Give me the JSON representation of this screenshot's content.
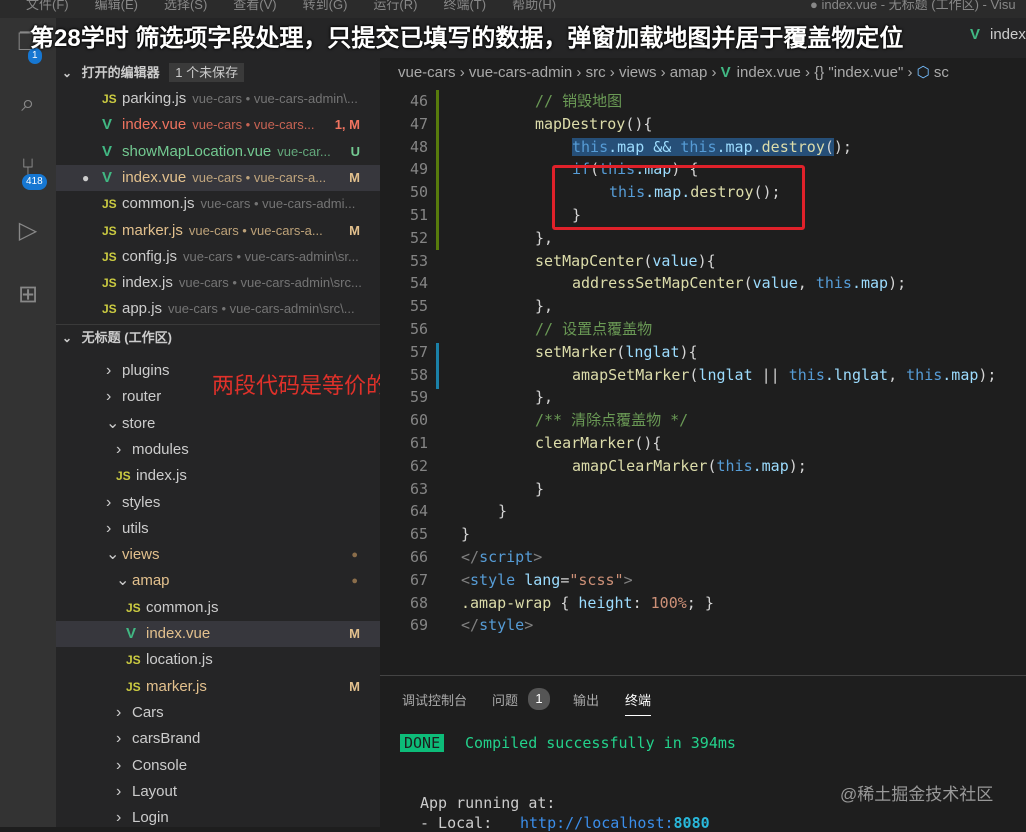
{
  "menubar": {
    "items": [
      "文件(F)",
      "编辑(E)",
      "选择(S)",
      "查看(V)",
      "转到(G)",
      "运行(R)",
      "终端(T)",
      "帮助(H)"
    ],
    "window_title": "● index.vue - 无标题 (工作区) - Visu"
  },
  "overlay_title": "第28学时 筛选项字段处理，只提交已填写的数据，弹窗加载地图并居于覆盖物定位",
  "activity": {
    "explorer_badge": "1",
    "scm_badge": "418"
  },
  "open_editors": {
    "title": "打开的编辑器",
    "unsaved": "1 个未保存",
    "items": [
      {
        "type": "js",
        "name": "parking.js",
        "desc": "vue-cars • vue-cars-admin\\...",
        "status": "",
        "color": "#ccc"
      },
      {
        "type": "vue",
        "name": "index.vue",
        "desc": "vue-cars • vue-cars...",
        "status": "1, M",
        "color": "#f0735f"
      },
      {
        "type": "vue",
        "name": "showMapLocation.vue",
        "desc": "vue-car...",
        "status": "U",
        "color": "#73c991"
      },
      {
        "type": "vue",
        "name": "index.vue",
        "desc": "vue-cars • vue-cars-a...",
        "status": "M",
        "color": "#e2c08d"
      },
      {
        "type": "js",
        "name": "common.js",
        "desc": "vue-cars • vue-cars-admi...",
        "status": "",
        "color": "#ccc"
      },
      {
        "type": "js",
        "name": "marker.js",
        "desc": "vue-cars • vue-cars-a...",
        "status": "M",
        "color": "#e2c08d"
      },
      {
        "type": "js",
        "name": "config.js",
        "desc": "vue-cars • vue-cars-admin\\sr...",
        "status": "",
        "color": "#ccc"
      },
      {
        "type": "js",
        "name": "index.js",
        "desc": "vue-cars • vue-cars-admin\\src...",
        "status": "",
        "color": "#ccc"
      },
      {
        "type": "js",
        "name": "app.js",
        "desc": "vue-cars • vue-cars-admin\\src\\...",
        "status": "",
        "color": "#ccc"
      }
    ]
  },
  "workspace": {
    "title": "无标题 (工作区)",
    "items": [
      {
        "kind": "folder",
        "open": false,
        "name": "plugins",
        "depth": 0
      },
      {
        "kind": "folder",
        "open": false,
        "name": "router",
        "depth": 0
      },
      {
        "kind": "folder",
        "open": true,
        "name": "store",
        "depth": 0
      },
      {
        "kind": "folder",
        "open": false,
        "name": "modules",
        "depth": 1
      },
      {
        "kind": "js",
        "name": "index.js",
        "depth": 1
      },
      {
        "kind": "folder",
        "open": false,
        "name": "styles",
        "depth": 0
      },
      {
        "kind": "folder",
        "open": false,
        "name": "utils",
        "depth": 0
      },
      {
        "kind": "folder",
        "open": true,
        "name": "views",
        "depth": 0,
        "color": "#e2c08d",
        "dot": true
      },
      {
        "kind": "folder",
        "open": true,
        "name": "amap",
        "depth": 1,
        "color": "#e2c08d",
        "dot": true
      },
      {
        "kind": "js",
        "name": "common.js",
        "depth": 2
      },
      {
        "kind": "vue",
        "name": "index.vue",
        "depth": 2,
        "status": "M",
        "color": "#e2c08d",
        "selected": true
      },
      {
        "kind": "js",
        "name": "location.js",
        "depth": 2
      },
      {
        "kind": "js",
        "name": "marker.js",
        "depth": 2,
        "status": "M",
        "color": "#e2c08d"
      },
      {
        "kind": "folder",
        "open": false,
        "name": "Cars",
        "depth": 1
      },
      {
        "kind": "folder",
        "open": false,
        "name": "carsBrand",
        "depth": 1
      },
      {
        "kind": "folder",
        "open": false,
        "name": "Console",
        "depth": 1
      },
      {
        "kind": "folder",
        "open": false,
        "name": "Layout",
        "depth": 1
      },
      {
        "kind": "folder",
        "open": false,
        "name": "Login",
        "depth": 1
      }
    ]
  },
  "annotation": "两段代码是等价的",
  "tab": {
    "label": "index"
  },
  "breadcrumb": [
    "vue-cars",
    "vue-cars-admin",
    "src",
    "views",
    "amap",
    "index.vue",
    "{} \"index.vue\"",
    "sc"
  ],
  "code": [
    {
      "n": "46",
      "i": 2,
      "tk": [
        [
          "// 销毁地图",
          "c"
        ]
      ]
    },
    {
      "n": "47",
      "i": 2,
      "tk": [
        [
          "mapDestroy",
          "f"
        ],
        [
          "(){",
          "p"
        ]
      ]
    },
    {
      "n": "48",
      "i": 3,
      "tk": [
        [
          "this",
          "k hl"
        ],
        [
          ".map && ",
          "v hl"
        ],
        [
          "this",
          "k hl"
        ],
        [
          ".map.",
          "v hl"
        ],
        [
          "destroy",
          "f hl"
        ],
        [
          "(",
          "p hl"
        ],
        [
          ");",
          "p"
        ]
      ]
    },
    {
      "n": "49",
      "i": 3,
      "tk": [
        [
          "if",
          "k"
        ],
        [
          "(",
          "p"
        ],
        [
          "this",
          "k"
        ],
        [
          ".map",
          "v"
        ],
        [
          ") {",
          "p"
        ]
      ]
    },
    {
      "n": "50",
      "i": 4,
      "tk": [
        [
          "this",
          "k"
        ],
        [
          ".map.",
          "v"
        ],
        [
          "destroy",
          "f"
        ],
        [
          "();",
          "p"
        ]
      ]
    },
    {
      "n": "51",
      "i": 3,
      "tk": [
        [
          "}",
          "p"
        ]
      ]
    },
    {
      "n": "52",
      "i": 2,
      "tk": [
        [
          "},",
          "p"
        ]
      ]
    },
    {
      "n": "53",
      "i": 2,
      "tk": [
        [
          "setMapCenter",
          "f"
        ],
        [
          "(",
          "p"
        ],
        [
          "value",
          "v"
        ],
        [
          "){",
          "p"
        ]
      ]
    },
    {
      "n": "54",
      "i": 3,
      "tk": [
        [
          "addressSetMapCenter",
          "f"
        ],
        [
          "(",
          "p"
        ],
        [
          "value",
          "v"
        ],
        [
          ", ",
          "p"
        ],
        [
          "this",
          "k"
        ],
        [
          ".map",
          "v"
        ],
        [
          ");",
          "p"
        ]
      ]
    },
    {
      "n": "55",
      "i": 2,
      "tk": [
        [
          "},",
          "p"
        ]
      ]
    },
    {
      "n": "56",
      "i": 2,
      "tk": [
        [
          "// 设置点覆盖物",
          "c"
        ]
      ]
    },
    {
      "n": "57",
      "i": 2,
      "tk": [
        [
          "setMarker",
          "f"
        ],
        [
          "(",
          "p"
        ],
        [
          "lnglat",
          "v"
        ],
        [
          "){",
          "p"
        ]
      ]
    },
    {
      "n": "58",
      "i": 3,
      "tk": [
        [
          "amapSetMarker",
          "f"
        ],
        [
          "(",
          "p"
        ],
        [
          "lnglat",
          "v"
        ],
        [
          " || ",
          "p"
        ],
        [
          "this",
          "k"
        ],
        [
          ".lnglat",
          "v"
        ],
        [
          ", ",
          "p"
        ],
        [
          "this",
          "k"
        ],
        [
          ".map",
          "v"
        ],
        [
          ");",
          "p"
        ]
      ]
    },
    {
      "n": "59",
      "i": 2,
      "tk": [
        [
          "},",
          "p"
        ]
      ]
    },
    {
      "n": "60",
      "i": 2,
      "tk": [
        [
          "/** 清除点覆盖物 */",
          "c"
        ]
      ]
    },
    {
      "n": "61",
      "i": 2,
      "tk": [
        [
          "clearMarker",
          "f"
        ],
        [
          "(){",
          "p"
        ]
      ]
    },
    {
      "n": "62",
      "i": 3,
      "tk": [
        [
          "amapClearMarker",
          "f"
        ],
        [
          "(",
          "p"
        ],
        [
          "this",
          "k"
        ],
        [
          ".map",
          "v"
        ],
        [
          ");",
          "p"
        ]
      ]
    },
    {
      "n": "63",
      "i": 2,
      "tk": [
        [
          "}",
          "p"
        ]
      ]
    },
    {
      "n": "64",
      "i": 1,
      "tk": [
        [
          "}",
          "p"
        ]
      ]
    },
    {
      "n": "65",
      "i": 0,
      "tk": [
        [
          "}",
          "p"
        ]
      ]
    },
    {
      "n": "66",
      "i": 0,
      "tk": [
        [
          "</",
          "t"
        ],
        [
          "script",
          "k"
        ],
        [
          ">",
          "t"
        ]
      ]
    },
    {
      "n": "67",
      "i": 0,
      "tk": [
        [
          "<",
          "t"
        ],
        [
          "style",
          "k"
        ],
        [
          " lang",
          "pr"
        ],
        [
          "=",
          "p"
        ],
        [
          "\"scss\"",
          "s"
        ],
        [
          ">",
          "t"
        ]
      ]
    },
    {
      "n": "68",
      "i": 0,
      "tk": [
        [
          ".amap-wrap",
          "f"
        ],
        [
          " { ",
          "p"
        ],
        [
          "height",
          "pr"
        ],
        [
          ": ",
          "p"
        ],
        [
          "100%",
          "s"
        ],
        [
          "; }",
          "p"
        ]
      ]
    },
    {
      "n": "69",
      "i": 0,
      "tk": [
        [
          "</",
          "t"
        ],
        [
          "style",
          "k"
        ],
        [
          ">",
          "t"
        ]
      ]
    }
  ],
  "panel": {
    "tabs": [
      "调试控制台",
      "问题",
      "输出",
      "终端"
    ],
    "problems_count": "1",
    "active": "终端",
    "done": "DONE",
    "compiled": "Compiled successfully in 394ms",
    "running": "App running at:",
    "local_label": "- Local:",
    "local_url": "http://localhost:",
    "local_port": "8080"
  },
  "watermark": "@稀土掘金技术社区"
}
